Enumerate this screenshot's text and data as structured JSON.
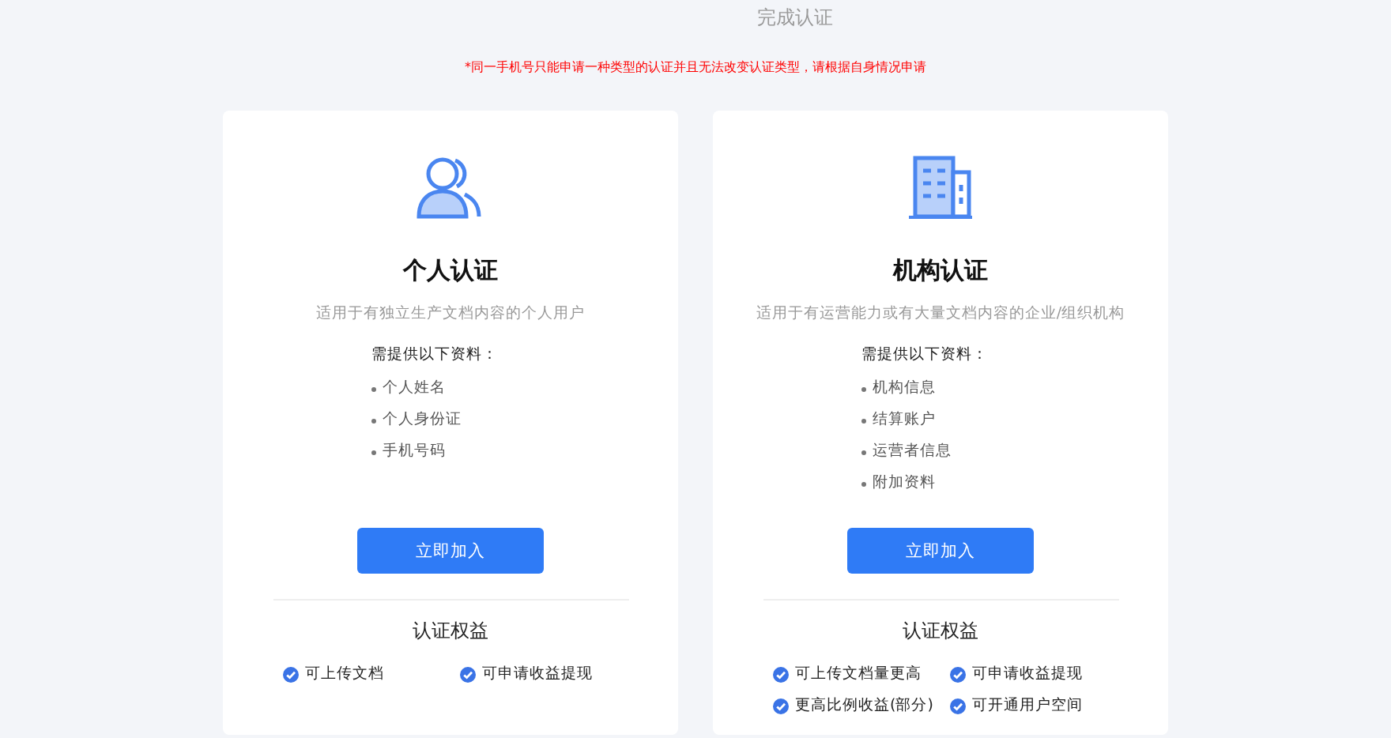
{
  "page_title": "完成认证",
  "notice": "*同一手机号只能申请一种类型的认证并且无法改变认证类型，请根据自身情况申请",
  "cards": [
    {
      "kind": "person",
      "title": "个人认证",
      "description": "适用于有独立生产文档内容的个人用户",
      "requirements_heading": "需提供以下资料：",
      "requirements": [
        "个人姓名",
        "个人身份证",
        "手机号码"
      ],
      "button": "立即加入",
      "benefits_heading": "认证权益",
      "benefits": [
        "可上传文档",
        "可申请收益提现"
      ]
    },
    {
      "kind": "organization",
      "title": "机构认证",
      "description": "适用于有运营能力或有大量文档内容的企业/组织机构",
      "requirements_heading": "需提供以下资料：",
      "requirements": [
        "机构信息",
        "结算账户",
        "运营者信息",
        "附加资料"
      ],
      "button": "立即加入",
      "benefits_heading": "认证权益",
      "benefits": [
        "可上传文档量更高",
        "可申请收益提现",
        "更高比例收益(部分)",
        "可开通用户空间"
      ]
    }
  ]
}
